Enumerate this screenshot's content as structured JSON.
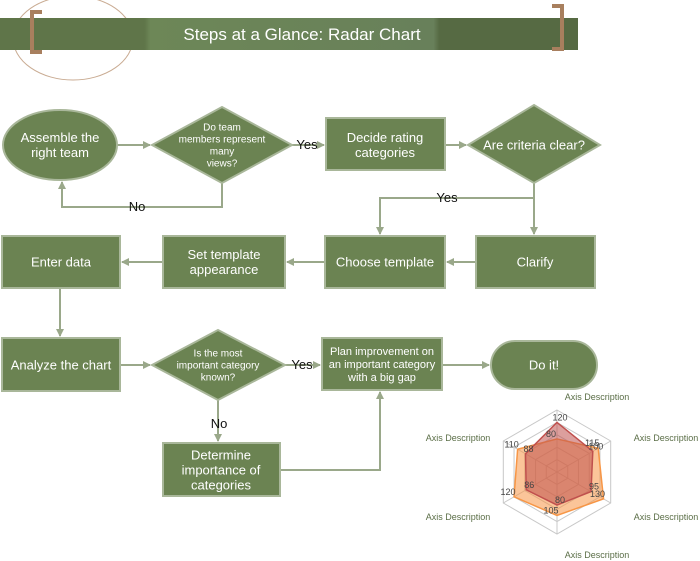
{
  "title": "Steps at a Glance: Radar Chart",
  "colors": {
    "shape_fill": "#6b8352",
    "shape_border": "#a9b79a",
    "connector": "#9aa88a",
    "banner": "#5a6e47",
    "bracket": "#a87f5e",
    "series1": "#c0504d",
    "series2": "#f79646"
  },
  "nodes": {
    "assemble": [
      "Assemble the",
      "right team"
    ],
    "represent": [
      "Do team",
      "members represent",
      "many",
      "views?"
    ],
    "decide": [
      "Decide rating",
      "categories"
    ],
    "criteria": [
      "Are criteria clear?"
    ],
    "clarify": [
      "Clarify"
    ],
    "choose": [
      "Choose template"
    ],
    "set": [
      "Set template",
      "appearance"
    ],
    "enter": [
      "Enter data"
    ],
    "analyze": [
      "Analyze the chart"
    ],
    "known": [
      "Is the most",
      "important category",
      "known?"
    ],
    "plan": [
      "Plan improvement on",
      "an important category",
      "with a big gap"
    ],
    "doit": [
      "Do it!"
    ],
    "determine": [
      "Determine",
      "importance of",
      "categories"
    ]
  },
  "connector_labels": {
    "no1": "No",
    "yes1": "Yes",
    "yes2": "Yes",
    "yes3": "Yes",
    "no2": "No"
  },
  "chart_data": {
    "type": "radar",
    "axes": [
      "Axis Description",
      "Axis Description",
      "Axis Description",
      "Axis Description",
      "Axis Description",
      "Axis Description"
    ],
    "series": [
      {
        "values": [
          120,
          100,
          95,
          80,
          86,
          88
        ]
      },
      {
        "values": [
          80,
          115,
          130,
          105,
          120,
          110
        ]
      }
    ],
    "rlim": [
      0,
      150
    ]
  }
}
